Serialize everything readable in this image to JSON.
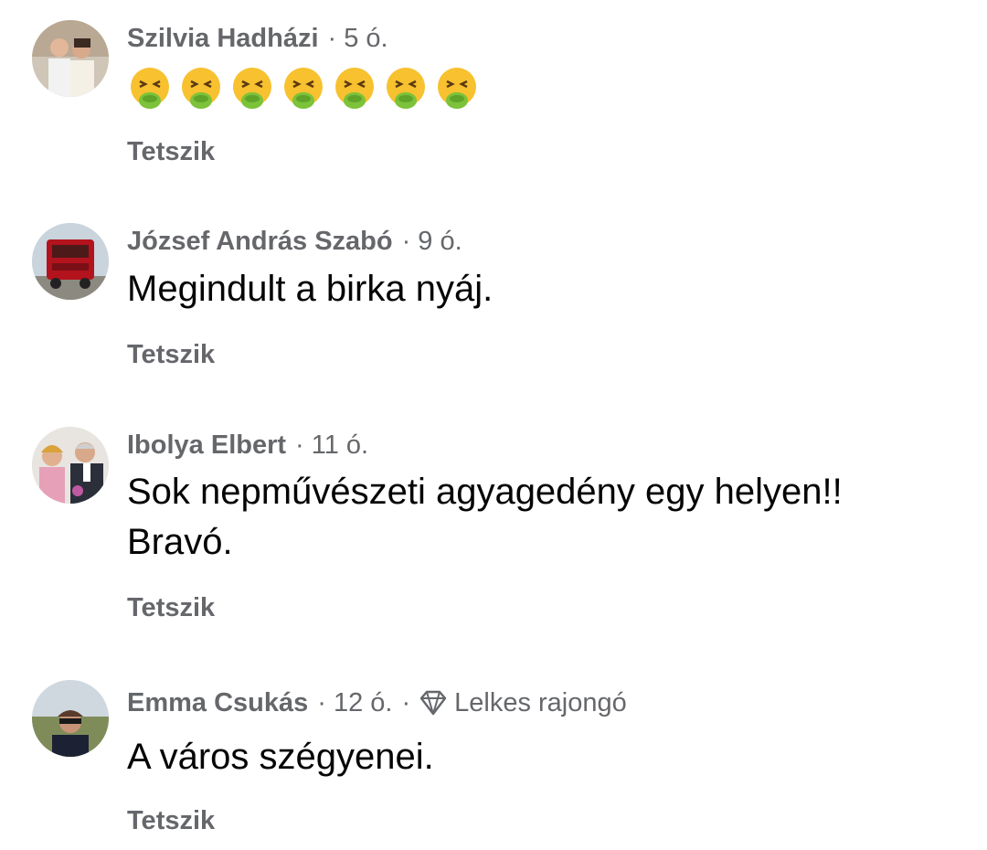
{
  "comments": [
    {
      "author": "Szilvia Hadházi",
      "time": "5 ó.",
      "text": "",
      "emoji": "nauseated-face",
      "emoji_count": 7,
      "like_label": "Tetszik"
    },
    {
      "author": "József András Szabó",
      "time": "9 ó.",
      "text": "Megindult a birka nyáj.",
      "like_label": "Tetszik"
    },
    {
      "author": "Ibolya Elbert",
      "time": "11 ó.",
      "text_line1": "Sok nepművészeti agyagedény egy helyen!!",
      "text_line2": "Bravó.",
      "like_label": "Tetszik"
    },
    {
      "author": "Emma Csukás",
      "time": "12 ó.",
      "badge": "Lelkes rajongó",
      "badge_icon": "diamond-icon",
      "text": "A város szégyenei.",
      "like_label": "Tetszik"
    }
  ],
  "separator": "·",
  "colors": {
    "meta_gray": "#65676b",
    "text_black": "#050505",
    "background": "#ffffff"
  }
}
